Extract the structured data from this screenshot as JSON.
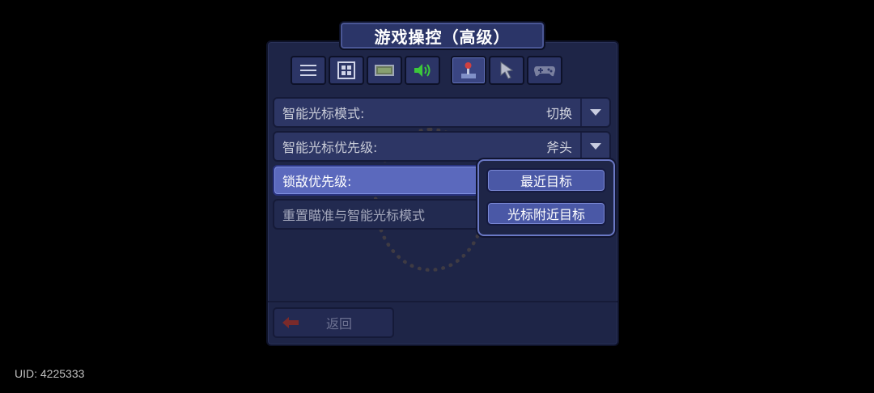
{
  "title": "游戏操控（高级）",
  "tabs": [
    {
      "icon": "menu-icon",
      "active": false
    },
    {
      "icon": "grid-icon",
      "active": false
    },
    {
      "icon": "display-icon",
      "active": false
    },
    {
      "icon": "sound-icon",
      "active": false
    },
    {
      "icon": "joystick-icon",
      "active": true
    },
    {
      "icon": "cursor-hand-icon",
      "active": false
    },
    {
      "icon": "gamepad-icon",
      "active": false
    }
  ],
  "settings": [
    {
      "label": "智能光标模式:",
      "value": "切换"
    },
    {
      "label": "智能光标优先级:",
      "value": "斧头"
    },
    {
      "label": "锁敌优先级:",
      "value": ""
    },
    {
      "label": "重置瞄准与智能光标模式",
      "value": ""
    }
  ],
  "dropdown": {
    "options": [
      "最近目标",
      "光标附近目标"
    ]
  },
  "back_label": "返回",
  "uid_text": "UID: 4225333",
  "colors": {
    "panel": "#1e2547",
    "row": "#2d3665",
    "highlight": "#5b69bd",
    "accent_red": "#c23030",
    "sound_green": "#3cc83c"
  }
}
